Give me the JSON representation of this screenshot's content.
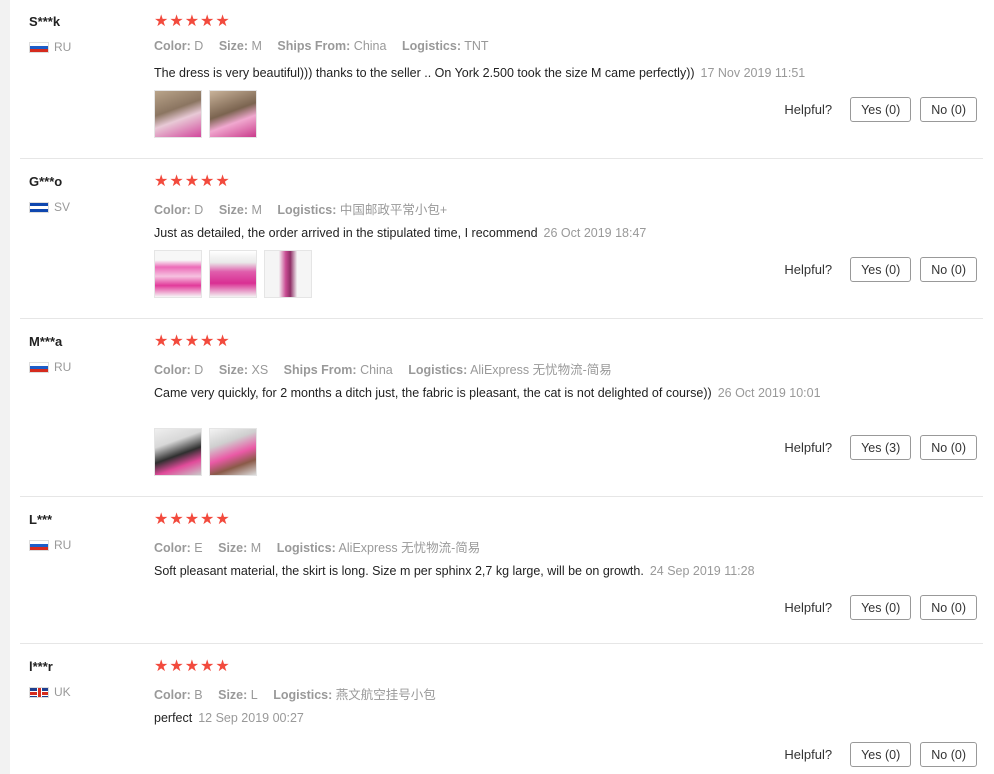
{
  "labels": {
    "color": "Color:",
    "size": "Size:",
    "ships_from": "Ships From:",
    "logistics": "Logistics:",
    "helpful": "Helpful?"
  },
  "reviews": [
    {
      "user": "S***k",
      "country": "RU",
      "stars": "★★★★★",
      "color": "D",
      "size": "M",
      "ships_from": "China",
      "logistics": "TNT",
      "text": "The dress is very beautiful))) thanks to the seller .. On York 2.500 took the size M came perfectly))",
      "date": "17 Nov 2019 11:51",
      "yes": "Yes (0)",
      "no": "No (0)"
    },
    {
      "user": "G***o",
      "country": "SV",
      "stars": "★★★★★",
      "color": "D",
      "size": "M",
      "logistics": "中国邮政平常小包+",
      "text": "Just as detailed, the order arrived in the stipulated time, I recommend",
      "date": "26 Oct 2019 18:47",
      "yes": "Yes (0)",
      "no": "No (0)"
    },
    {
      "user": "M***a",
      "country": "RU",
      "stars": "★★★★★",
      "color": "D",
      "size": "XS",
      "ships_from": "China",
      "logistics": "AliExpress 无忧物流-简易",
      "text": "Came very quickly, for 2 months a ditch just, the fabric is pleasant, the cat is not delighted of course))",
      "date": "26 Oct 2019 10:01",
      "yes": "Yes (3)",
      "no": "No (0)"
    },
    {
      "user": "L***",
      "country": "RU",
      "stars": "★★★★★",
      "color": "E",
      "size": "M",
      "logistics": "AliExpress 无忧物流-简易",
      "text": "Soft pleasant material, the skirt is long. Size m per sphinx 2,7 kg large, will be on growth.",
      "date": "24 Sep 2019 11:28",
      "yes": "Yes (0)",
      "no": "No (0)"
    },
    {
      "user": "l***r",
      "country": "UK",
      "stars": "★★★★★",
      "color": "B",
      "size": "L",
      "logistics": "燕文航空挂号小包",
      "text": "perfect",
      "date": "12 Sep 2019 00:27",
      "yes": "Yes (0)",
      "no": "No (0)"
    }
  ]
}
